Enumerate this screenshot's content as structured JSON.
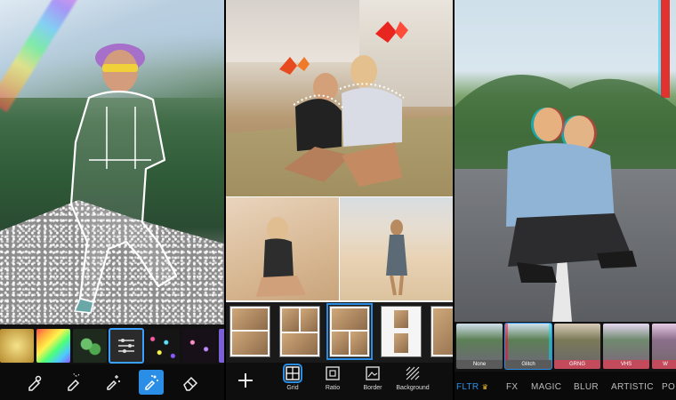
{
  "panel1": {
    "thumbs": [
      {
        "name": "gold-sticker"
      },
      {
        "name": "rainbow-sticker"
      },
      {
        "name": "clover-sticker"
      },
      {
        "name": "glitter-brush-sticker",
        "selected": true
      },
      {
        "name": "confetti-sticker"
      },
      {
        "name": "sparkle-sticker"
      }
    ],
    "tools": [
      {
        "icon": "eraser-brush-icon"
      },
      {
        "icon": "lasso-brush-icon"
      },
      {
        "icon": "sparkle-brush-icon"
      },
      {
        "icon": "magic-brush-icon",
        "active": true
      },
      {
        "icon": "eraser-icon"
      }
    ]
  },
  "panel2": {
    "toolbar": {
      "add_icon": "plus-icon",
      "items": [
        {
          "label": "Grid",
          "icon": "grid-icon",
          "active": true
        },
        {
          "label": "Ratio",
          "icon": "ratio-icon"
        },
        {
          "label": "Border",
          "icon": "border-icon"
        },
        {
          "label": "Background",
          "icon": "background-icon"
        }
      ]
    }
  },
  "panel3": {
    "filters": [
      {
        "label": "None"
      },
      {
        "label": "Glitch",
        "selected": true
      },
      {
        "label": "GRNG"
      },
      {
        "label": "VHS"
      },
      {
        "label": "W"
      }
    ],
    "tabs": [
      {
        "label": "FLTR",
        "active": true,
        "badge": "♛"
      },
      {
        "label": "FX"
      },
      {
        "label": "MAGIC"
      },
      {
        "label": "BLUR"
      },
      {
        "label": "ARTISTIC"
      },
      {
        "label": "PO"
      }
    ],
    "colors": {
      "accent": "#2a8ee6"
    }
  }
}
